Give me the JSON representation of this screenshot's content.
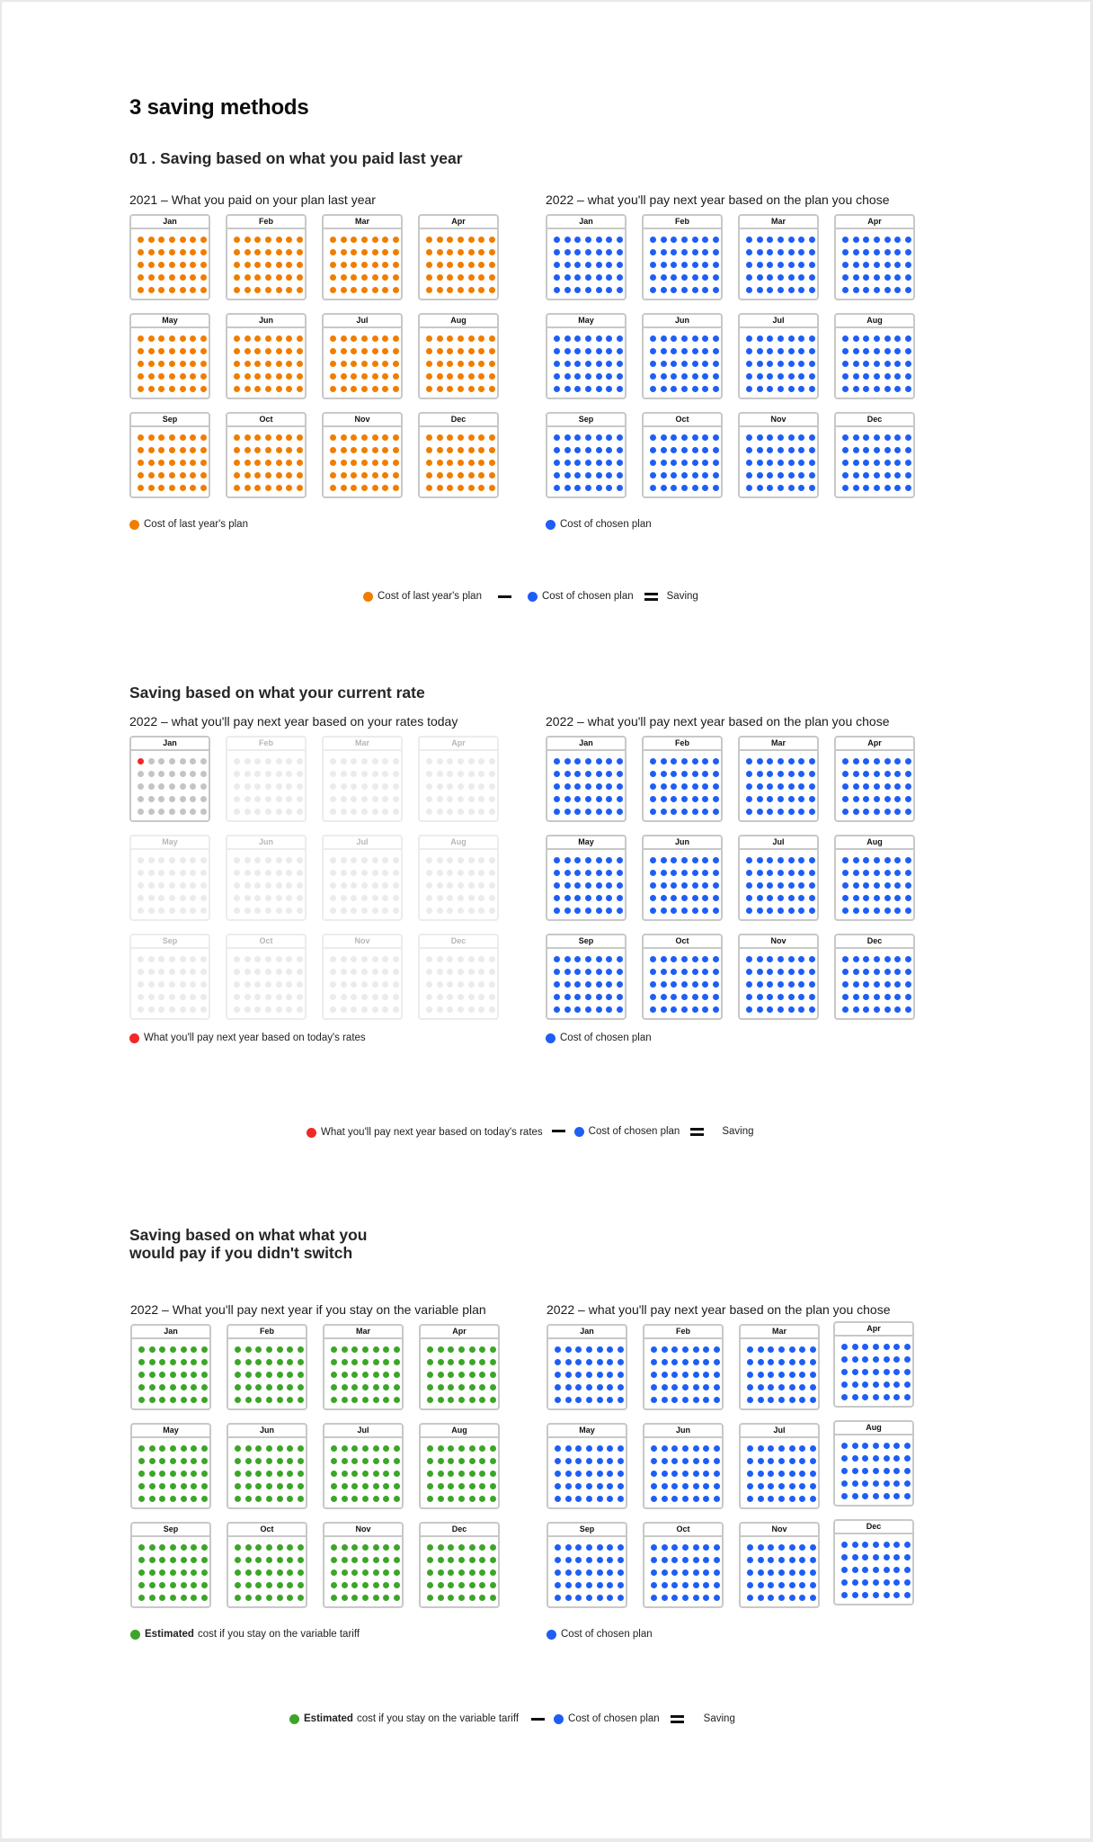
{
  "page_title": "3 saving methods",
  "colors": {
    "last_year": "#F07D00",
    "chosen_plan": "#1F5EF5",
    "today_rate": "#F02828",
    "variable": "#3DA52A",
    "inactive_dot": "#C4C4C4",
    "faded_dot": "#EBEBEB"
  },
  "months": [
    "Jan",
    "Feb",
    "Mar",
    "Apr",
    "May",
    "Jun",
    "Jul",
    "Aug",
    "Sep",
    "Oct",
    "Nov",
    "Dec"
  ],
  "grid": {
    "columns": 7,
    "rows": 5
  },
  "sections": [
    {
      "title": "01 . Saving based on what you paid last year",
      "left": {
        "subtitle": "2021 – What you paid on your plan last year",
        "legend": "Cost of last year's plan",
        "color_key": "last_year"
      },
      "right": {
        "subtitle": "2022 – what you'll pay next year based on the plan you chose",
        "legend": "Cost of chosen plan",
        "color_key": "chosen_plan"
      },
      "equation": {
        "term1_bold": "",
        "term1": "Cost of last year's plan",
        "term2": "Cost of chosen plan",
        "result": "Saving"
      }
    },
    {
      "title": "Saving based on what your current rate",
      "left": {
        "subtitle": "2022 – what you'll pay next year based on your rates today",
        "legend": "What you'll pay next year based on today's rates",
        "color_key": "today_rate",
        "active_month": "Jan",
        "highlighted_dots": 1
      },
      "right": {
        "subtitle": "2022 – what you'll pay next year based on the plan you chose",
        "legend": "Cost of chosen plan",
        "color_key": "chosen_plan"
      },
      "equation": {
        "term1_bold": "",
        "term1": "What you'll pay next year based on today's rates",
        "term2": "Cost of chosen plan",
        "result": "Saving"
      }
    },
    {
      "title_line1": "Saving based on what what you",
      "title_line2": "would pay if you didn't switch",
      "left": {
        "subtitle": "2022 – What you'll pay next year if you stay on the variable plan",
        "legend_bold": "Estimated",
        "legend": "cost if you stay on the variable tariff",
        "color_key": "variable"
      },
      "right": {
        "subtitle": "2022 – what you'll pay next year based on the plan you chose",
        "legend": "Cost of chosen plan",
        "color_key": "chosen_plan"
      },
      "equation": {
        "term1_bold": "Estimated",
        "term1": "cost if you stay on the variable tariff",
        "term2": "Cost of chosen plan",
        "result": "Saving"
      }
    }
  ]
}
